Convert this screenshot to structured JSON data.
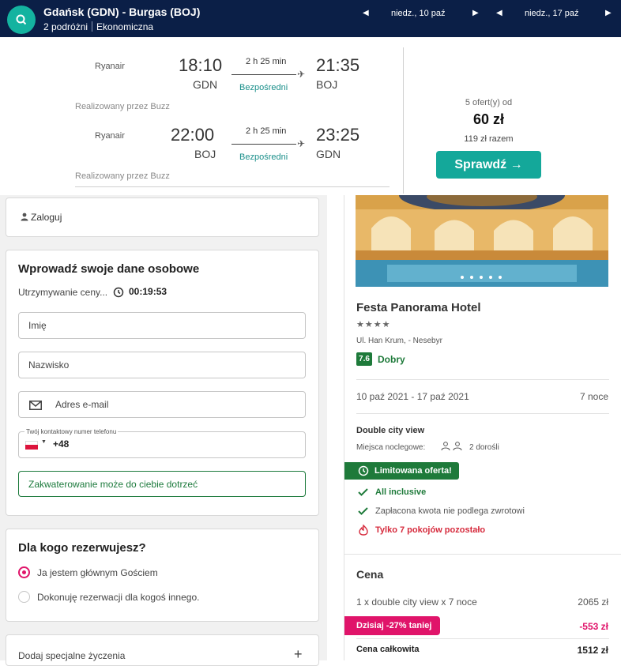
{
  "header": {
    "route": "Gdańsk (GDN) - Burgas (BOJ)",
    "travellers": "2 podróżni",
    "cabin": "Ekonomiczna",
    "depart_date": "niedz., 10 paź",
    "return_date": "niedz., 17 paź"
  },
  "flights": [
    {
      "airline": "Ryanair",
      "dep_time": "18:10",
      "dep_code": "GDN",
      "duration": "2 h 25 min",
      "type": "Bezpośredni",
      "arr_time": "21:35",
      "arr_code": "BOJ",
      "operated": "Realizowany przez Buzz"
    },
    {
      "airline": "Ryanair",
      "dep_time": "22:00",
      "dep_code": "BOJ",
      "duration": "2 h 25 min",
      "type": "Bezpośredni",
      "arr_time": "23:25",
      "arr_code": "GDN",
      "operated": "Realizowany przez Buzz"
    }
  ],
  "offer": {
    "offers_from": "5 ofert(y) od",
    "price": "60 zł",
    "total": "119 zł razem",
    "button": "Sprawdź →"
  },
  "login": {
    "label": "Zaloguj"
  },
  "personal": {
    "title": "Wprowadź swoje dane osobowe",
    "hold_label": "Utrzymywanie ceny...",
    "timer": "00:19:53",
    "first_name": "Imię",
    "last_name": "Nazwisko",
    "email": "Adres e-mail",
    "phone_label": "Twój kontaktowy numer telefonu",
    "phone_code": "+48",
    "notice": "Zakwaterowanie może do ciebie dotrzeć"
  },
  "booking_for": {
    "title": "Dla kogo rezerwujesz?",
    "options": [
      "Ja jestem głównym Gościem",
      "Dokonuję rezerwacji dla kogoś innego."
    ]
  },
  "special": {
    "label": "Dodaj specjalne życzenia"
  },
  "hotel": {
    "name": "Festa Panorama Hotel",
    "stars": "★★★★",
    "address": "Ul. Han Krum, - Nesebyr",
    "score": "7.6",
    "score_label": "Dobry",
    "dates": "10 paź 2021 - 17 paź 2021",
    "nights": "7 noce",
    "room": "Double city view",
    "berths_label": "Miejsca noclegowe:",
    "adults": "2 dorośli",
    "limited": "Limitowana oferta!",
    "all_inclusive": "All inclusive",
    "nonrefundable": "Zapłacona kwota nie podlega zwrotowi",
    "rooms_left": "Tylko 7 pokojów pozostało"
  },
  "price": {
    "title": "Cena",
    "line_label": "1 x double city view x 7 noce",
    "line_value": "2065 zł",
    "discount_label": "Dzisiaj -27% taniej",
    "discount_value": "-553 zł",
    "total_label": "Cena całkowita",
    "total_value": "1512 zł"
  },
  "colors": {
    "navy": "#0b1f47",
    "teal": "#14a89a",
    "green": "#1e7a3a",
    "pink": "#e0146a"
  }
}
